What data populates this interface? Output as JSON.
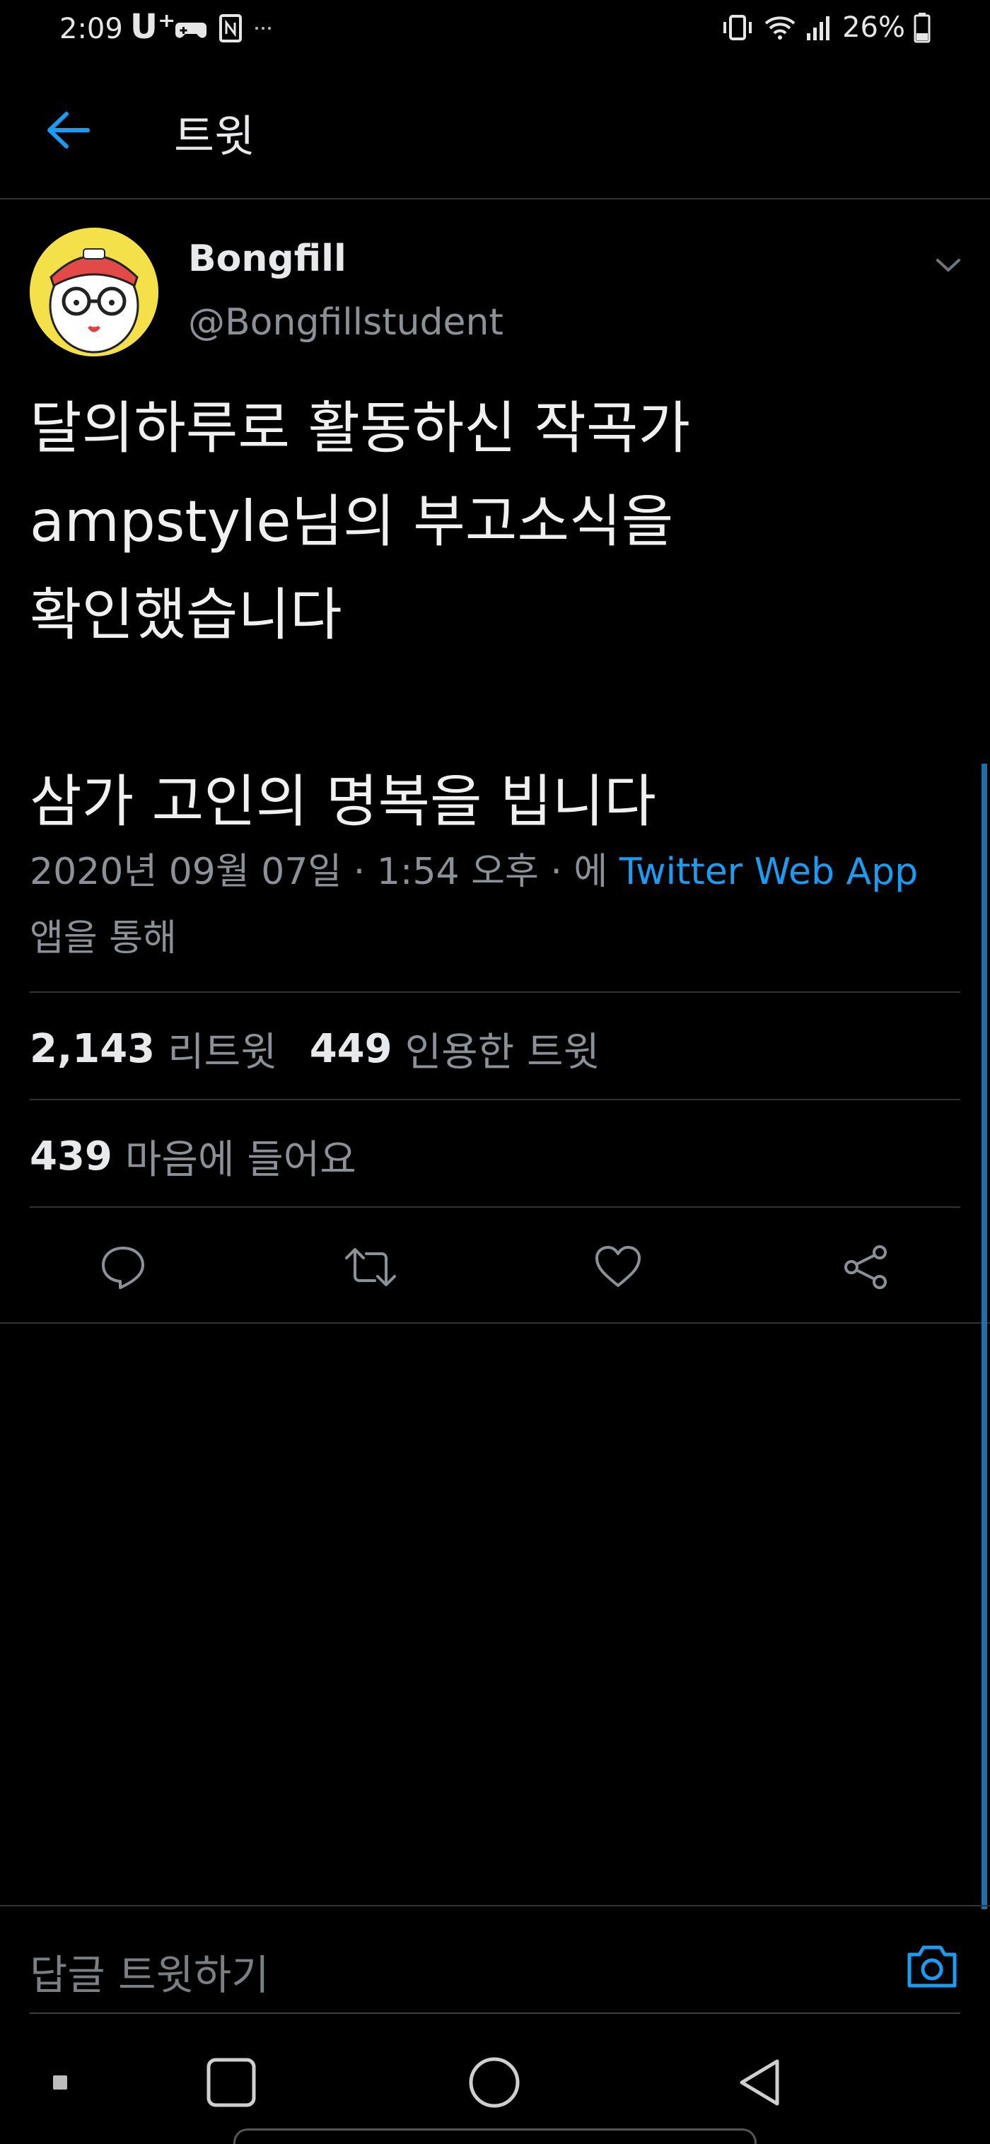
{
  "status_bar": {
    "time": "2:09",
    "carrier": "U⁺",
    "battery": "26%",
    "icons": [
      "game-controller-icon",
      "nfc-icon",
      "more-dots-icon",
      "vibrate-icon",
      "wifi-icon",
      "signal-icon",
      "battery-icon"
    ]
  },
  "header": {
    "title": "트윗",
    "back_icon": "back-arrow-icon"
  },
  "tweet": {
    "author_name": "Bongfill",
    "author_handle": "@Bongfillstudent",
    "text": "달의하루로 활동하신 작곡가\nampstyle님의 부고소식을\n확인했습니다\n\n삼가 고인의 명복을 빕니다",
    "timestamp": "2020년 09월 07일 · 1:54 오후 · 에",
    "source_app": "Twitter Web App",
    "source_suffix": "앱을 통해"
  },
  "stats": {
    "retweets_count": "2,143",
    "retweets_label": "리트윗",
    "quotes_count": "449",
    "quotes_label": "인용한 트윗",
    "likes_count": "439",
    "likes_label": "마음에 들어요"
  },
  "actions": [
    "reply-icon",
    "retweet-icon",
    "like-icon",
    "share-icon"
  ],
  "reply_bar": {
    "placeholder": "답글 트윗하기",
    "camera_icon": "camera-icon"
  },
  "colors": {
    "accent": "#1d9bf0",
    "background": "#000000",
    "muted_text": "#8b9197",
    "divider": "#2f3336"
  }
}
